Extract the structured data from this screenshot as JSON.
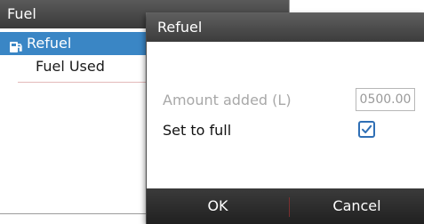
{
  "fuel_panel": {
    "title": "Fuel",
    "items": [
      {
        "label": "Refuel",
        "icon": "fuel-pump-icon",
        "selected": true
      },
      {
        "label": "Fuel Used",
        "selected": false
      }
    ]
  },
  "dialog": {
    "title": "Refuel",
    "amount_label": "Amount added  (L)",
    "amount_value": "0500.00",
    "set_full_label": "Set to full",
    "set_full_checked": true,
    "ok_label": "OK",
    "cancel_label": "Cancel"
  },
  "colors": {
    "selection": "#3a86c5",
    "checkbox": "#2f6fb5",
    "header_dark": "#3a3a3a",
    "disabled_text": "#a8a8a8"
  }
}
